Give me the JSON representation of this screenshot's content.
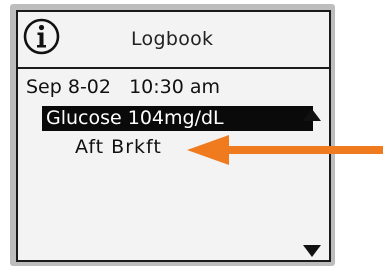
{
  "screen": {
    "title": "Logbook",
    "entry": {
      "datetime": "Sep 8-02   10:30 am",
      "reading": "Glucose 104mg/dL",
      "note": "Aft Brkft"
    },
    "icons": {
      "header": "info-icon",
      "scroll_up": "scroll-up-arrow-icon",
      "scroll_down": "scroll-down-arrow-icon"
    }
  },
  "callout": {
    "arrow_color": "#f07a1e"
  },
  "colors": {
    "selection_background": "#0a0a0a",
    "selection_text": "#ffffff",
    "screen_background": "#f3f3f3"
  }
}
